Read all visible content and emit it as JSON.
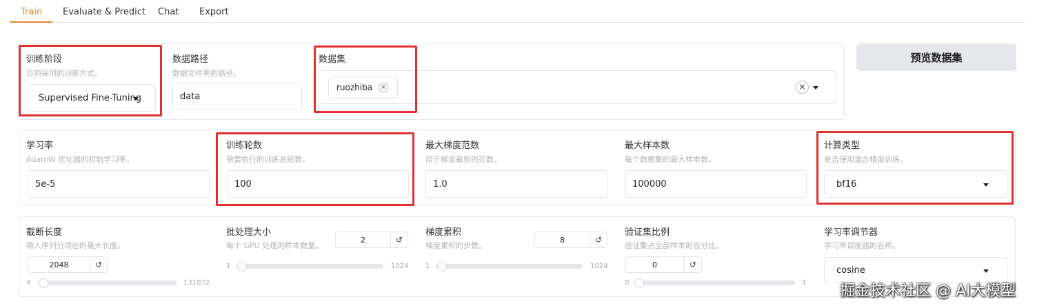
{
  "tabs": [
    "Train",
    "Evaluate & Predict",
    "Chat",
    "Export"
  ],
  "preview_button": "预览数据集",
  "stage": {
    "label": "训练阶段",
    "info": "目前采用的训练方式。",
    "value": "Supervised Fine-Tuning"
  },
  "dataset_dir": {
    "label": "数据路径",
    "info": "数据文件夹的路径。",
    "value": "data"
  },
  "dataset": {
    "label": "数据集",
    "chips": [
      "ruozhiba"
    ]
  },
  "learning_rate": {
    "label": "学习率",
    "info": "AdamW 优化器的初始学习率。",
    "value": "5e-5"
  },
  "num_epochs": {
    "label": "训练轮数",
    "info": "需要执行的训练总轮数。",
    "value": "100"
  },
  "max_grad_norm": {
    "label": "最大梯度范数",
    "info": "用于梯度裁剪的范数。",
    "value": "1.0"
  },
  "max_samples": {
    "label": "最大样本数",
    "info": "每个数据集的最大样本数。",
    "value": "100000"
  },
  "compute_type": {
    "label": "计算类型",
    "info": "是否使用混合精度训练。",
    "value": "bf16"
  },
  "cutoff_len": {
    "label": "截断长度",
    "info": "输入序列分词后的最大长度。",
    "value": "2048",
    "min": "4",
    "max": "131072",
    "level": 0.0156
  },
  "batch_size": {
    "label": "批处理大小",
    "info": "每个 GPU 处理的样本数量。",
    "value": "2",
    "min": "1",
    "max": "1024",
    "level": 0.001
  },
  "grad_accum": {
    "label": "梯度累积",
    "info": "梯度累积的步数。",
    "value": "8",
    "min": "1",
    "max": "1024",
    "level": 0.007
  },
  "val_size": {
    "label": "验证集比例",
    "info": "验证集占全部样本的百分比。",
    "value": "0",
    "min": "0",
    "max": "1",
    "level": 0
  },
  "lr_scheduler": {
    "label": "学习率调节器",
    "info": "学习率调度器的名称。",
    "value": "cosine"
  },
  "icons": {
    "reset": "↺",
    "chip_close": "×",
    "clear": "×"
  },
  "watermark": "掘金技术社区 @ AI大模型",
  "colors": {
    "accent": "#e8852d",
    "highlight": "#e03131"
  }
}
